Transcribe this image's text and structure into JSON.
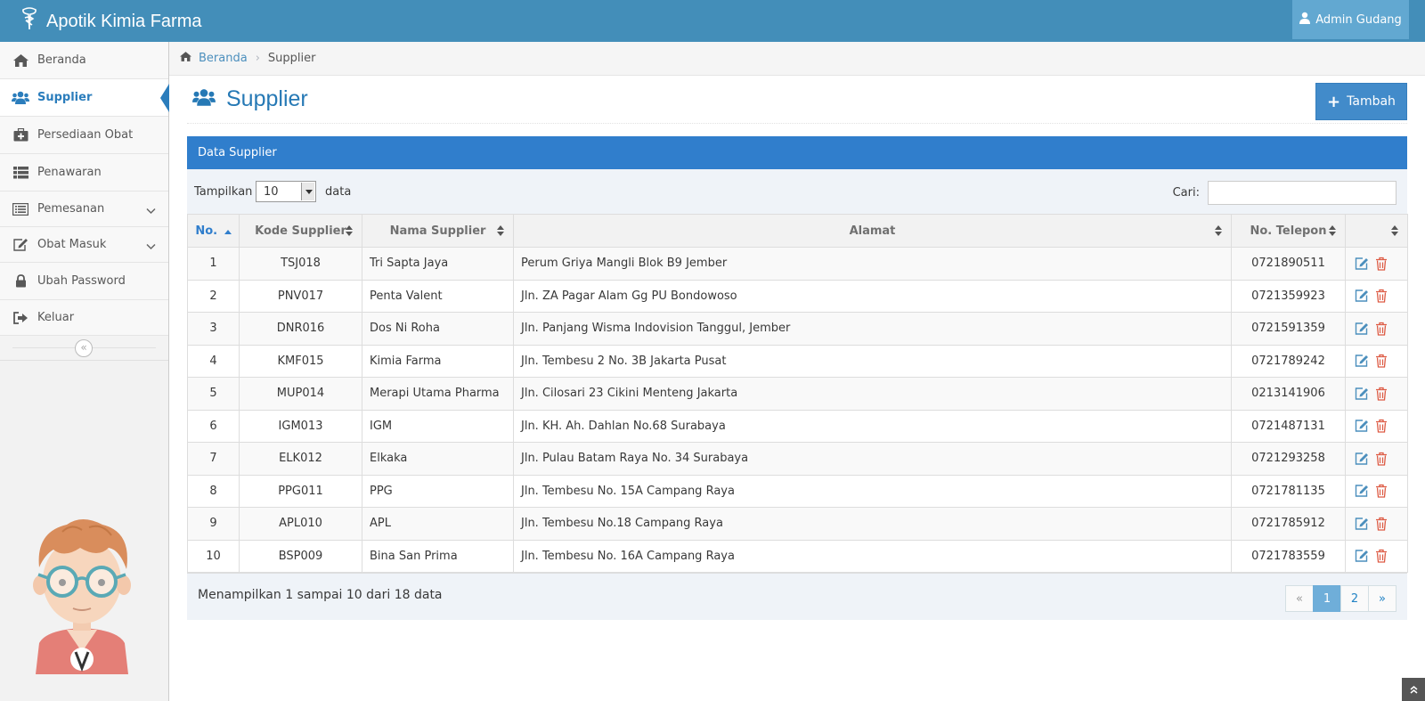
{
  "app": {
    "title": "Apotik Kimia Farma"
  },
  "user": {
    "name": "Admin Gudang"
  },
  "sidebar": {
    "items": [
      {
        "label": "Beranda",
        "icon": "home-icon"
      },
      {
        "label": "Supplier",
        "icon": "users-icon",
        "active": true
      },
      {
        "label": "Persediaan Obat",
        "icon": "medkit-icon"
      },
      {
        "label": "Penawaran",
        "icon": "list-icon"
      },
      {
        "label": "Pemesanan",
        "icon": "list-alt-icon",
        "has_submenu": true
      },
      {
        "label": "Obat Masuk",
        "icon": "edit-icon",
        "has_submenu": true
      },
      {
        "label": "Ubah Password",
        "icon": "lock-icon"
      },
      {
        "label": "Keluar",
        "icon": "sign-out-icon"
      }
    ],
    "collapse_glyph": "«"
  },
  "breadcrumb": {
    "home": "Beranda",
    "current": "Supplier"
  },
  "page": {
    "title": "Supplier",
    "add_button": "Tambah"
  },
  "panel": {
    "title": "Data Supplier"
  },
  "table_controls": {
    "show_label": "Tampilkan",
    "page_size": "10",
    "show_suffix": "data",
    "search_label": "Cari:",
    "search_value": ""
  },
  "table": {
    "columns": [
      "No.",
      "Kode Supplier",
      "Nama Supplier",
      "Alamat",
      "No. Telepon",
      ""
    ],
    "rows": [
      {
        "no": "1",
        "kode": "TSJ018",
        "nama": "Tri Sapta Jaya",
        "alamat": "Perum Griya Mangli Blok B9 Jember",
        "telepon": "0721890511"
      },
      {
        "no": "2",
        "kode": "PNV017",
        "nama": "Penta Valent",
        "alamat": "Jln. ZA Pagar Alam Gg PU Bondowoso",
        "telepon": "0721359923"
      },
      {
        "no": "3",
        "kode": "DNR016",
        "nama": "Dos Ni Roha",
        "alamat": "Jln. Panjang Wisma Indovision Tanggul, Jember",
        "telepon": "0721591359"
      },
      {
        "no": "4",
        "kode": "KMF015",
        "nama": "Kimia Farma",
        "alamat": "Jln. Tembesu 2 No. 3B Jakarta Pusat",
        "telepon": "0721789242"
      },
      {
        "no": "5",
        "kode": "MUP014",
        "nama": "Merapi Utama Pharma",
        "alamat": "Jln. Cilosari 23 Cikini Menteng Jakarta",
        "telepon": "0213141906"
      },
      {
        "no": "6",
        "kode": "IGM013",
        "nama": "IGM",
        "alamat": "Jln. KH. Ah. Dahlan No.68 Surabaya",
        "telepon": "0721487131"
      },
      {
        "no": "7",
        "kode": "ELK012",
        "nama": "Elkaka",
        "alamat": "Jln. Pulau Batam Raya No. 34 Surabaya",
        "telepon": "0721293258"
      },
      {
        "no": "8",
        "kode": "PPG011",
        "nama": "PPG",
        "alamat": "Jln. Tembesu No. 15A Campang Raya",
        "telepon": "0721781135"
      },
      {
        "no": "9",
        "kode": "APL010",
        "nama": "APL",
        "alamat": "Jln. Tembesu No.18 Campang Raya",
        "telepon": "0721785912"
      },
      {
        "no": "10",
        "kode": "BSP009",
        "nama": "Bina San Prima",
        "alamat": "Jln. Tembesu No. 16A Campang Raya",
        "telepon": "0721783559"
      }
    ]
  },
  "pagination": {
    "info": "Menampilkan 1 sampai 10 dari 18 data",
    "prev": "«",
    "pages": [
      "1",
      "2"
    ],
    "current": "1",
    "next": "»"
  },
  "colors": {
    "navbar": "#438eb9",
    "accent": "#2b7dbc",
    "panel_header": "#307ecc",
    "edit_icon": "#4c8fbd",
    "delete_icon": "#dd5a43"
  }
}
